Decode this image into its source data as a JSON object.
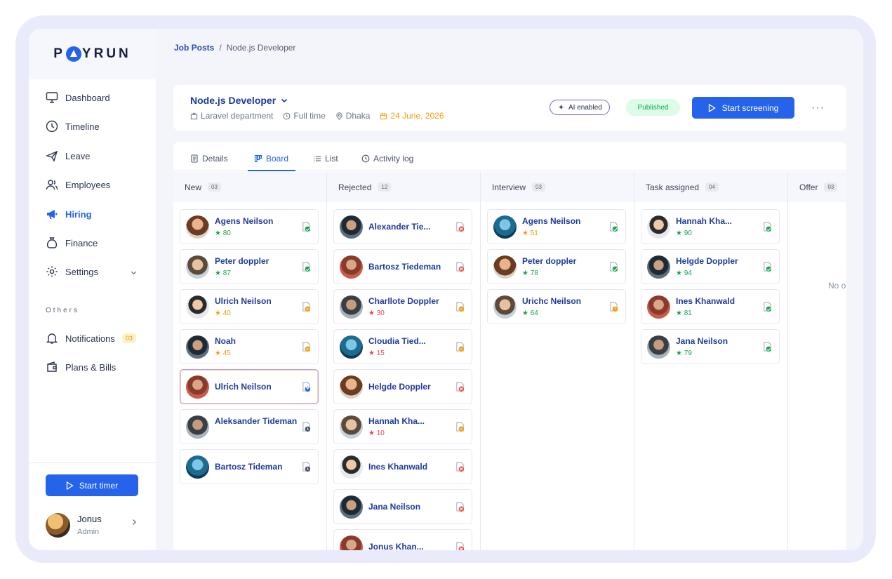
{
  "brand": {
    "logo_before": "P",
    "logo_after": "YRUN"
  },
  "sidebar": {
    "items": [
      {
        "label": "Dashboard"
      },
      {
        "label": "Timeline"
      },
      {
        "label": "Leave"
      },
      {
        "label": "Employees"
      },
      {
        "label": "Hiring"
      },
      {
        "label": "Finance"
      },
      {
        "label": "Settings"
      }
    ],
    "others_label": "Others",
    "others": [
      {
        "label": "Notifications",
        "badge": "03"
      },
      {
        "label": "Plans & Bills"
      }
    ],
    "timer_label": "Start timer",
    "user": {
      "name": "Jonus",
      "role": "Admin"
    }
  },
  "breadcrumb": {
    "parent": "Job Posts",
    "separator": "/",
    "current": "Node.js Developer"
  },
  "job": {
    "title": "Node.js Developer",
    "department": "Laravel department",
    "type": "Full time",
    "location": "Dhaka",
    "date": "24 June, 2026",
    "ai_label": "AI enabled",
    "status": "Published",
    "screen_label": "Start screening",
    "more": "···"
  },
  "tabs": [
    {
      "label": "Details"
    },
    {
      "label": "Board"
    },
    {
      "label": "List"
    },
    {
      "label": "Activity log"
    }
  ],
  "columns": [
    {
      "title": "New",
      "count": "03",
      "cards": [
        {
          "name": "Agens Neilson",
          "score": "★ 80",
          "tone": "g",
          "status": "approved"
        },
        {
          "name": "Peter doppler",
          "score": "★ 87",
          "tone": "g",
          "status": "approved"
        },
        {
          "name": "Ulrich Neilson",
          "score": "★ 40",
          "tone": "o",
          "status": "review"
        },
        {
          "name": "Noah",
          "score": "★ 45",
          "tone": "o",
          "status": "review"
        },
        {
          "name": "Ulrich Neilson",
          "score": "",
          "tone": "",
          "status": "processing"
        },
        {
          "name": "Aleksander Tideman",
          "score": "",
          "tone": "",
          "status": "pending"
        },
        {
          "name": "Bartosz Tideman",
          "score": "",
          "tone": "",
          "status": "pending"
        }
      ]
    },
    {
      "title": "Rejected",
      "count": "12",
      "cards": [
        {
          "name": "Alexander Tie...",
          "score": "",
          "tone": "",
          "status": "rejected"
        },
        {
          "name": "Bartosz Tiedeman",
          "score": "",
          "tone": "",
          "status": "rejected"
        },
        {
          "name": "Charllote Doppler",
          "score": "★ 30",
          "tone": "r",
          "status": "review"
        },
        {
          "name": "Cloudia Tied...",
          "score": "★ 15",
          "tone": "r",
          "status": "review"
        },
        {
          "name": "Helgde Doppler",
          "score": "",
          "tone": "",
          "status": "rejected"
        },
        {
          "name": "Hannah Kha...",
          "score": "★ 10",
          "tone": "r",
          "status": "review"
        },
        {
          "name": "Ines Khanwald",
          "score": "",
          "tone": "",
          "status": "rejected"
        },
        {
          "name": "Jana Neilson",
          "score": "",
          "tone": "",
          "status": "rejected"
        },
        {
          "name": "Jonus Khan...",
          "score": "",
          "tone": "",
          "status": "rejected"
        }
      ]
    },
    {
      "title": "Interview",
      "count": "03",
      "cards": [
        {
          "name": "Agens Neilson",
          "score": "★ 51",
          "tone": "o",
          "status": "approved"
        },
        {
          "name": "Peter doppler",
          "score": "★ 78",
          "tone": "g",
          "status": "approved"
        },
        {
          "name": "Urichc Neilson",
          "score": "★ 64",
          "tone": "g",
          "status": "warning"
        }
      ]
    },
    {
      "title": "Task assigned",
      "count": "04",
      "cards": [
        {
          "name": "Hannah Kha...",
          "score": "★ 90",
          "tone": "g",
          "status": "approved"
        },
        {
          "name": "Helgde Doppler",
          "score": "★ 94",
          "tone": "g",
          "status": "approved"
        },
        {
          "name": "Ines Khanwald",
          "score": "★ 81",
          "tone": "g",
          "status": "approved"
        },
        {
          "name": "Jana Neilson",
          "score": "★ 79",
          "tone": "g",
          "status": "approved"
        }
      ]
    },
    {
      "title": "Offer",
      "count": "03",
      "cards": [],
      "empty": "No o"
    }
  ],
  "colors": {
    "accent": "#2563eb",
    "success": "#16a34a",
    "warning": "#f59e0b",
    "danger": "#ef4444"
  }
}
